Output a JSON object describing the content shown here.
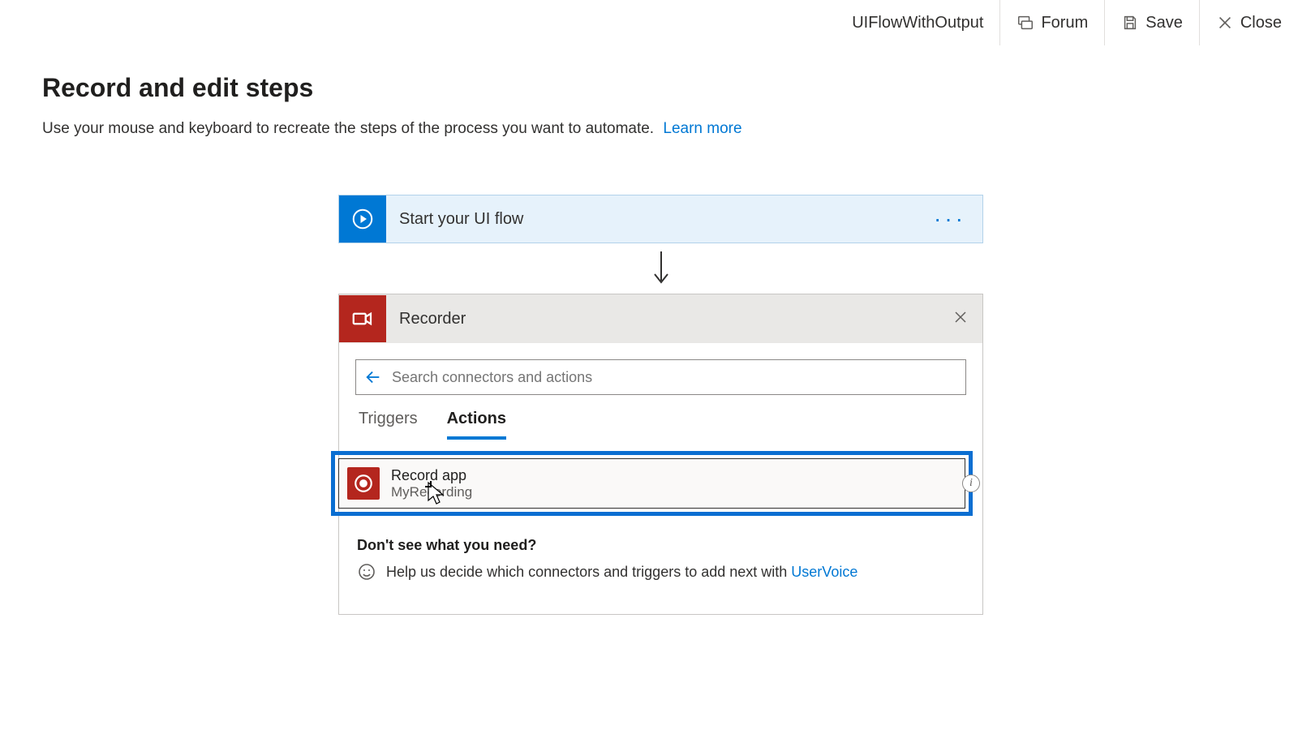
{
  "header": {
    "flow_name": "UIFlowWithOutput",
    "forum_label": "Forum",
    "save_label": "Save",
    "close_label": "Close"
  },
  "page": {
    "title": "Record and edit steps",
    "description": "Use your mouse and keyboard to recreate the steps of the process you want to automate.",
    "learn_more": "Learn more"
  },
  "flow": {
    "start_label": "Start your UI flow"
  },
  "recorder": {
    "title": "Recorder",
    "search_placeholder": "Search connectors and actions",
    "tabs": {
      "triggers": "Triggers",
      "actions": "Actions"
    },
    "action": {
      "title": "Record app",
      "subtitle": "MyRecording"
    },
    "help": {
      "question": "Don't see what you need?",
      "text": "Help us decide which connectors and triggers to add next with",
      "link": "UserVoice"
    }
  }
}
